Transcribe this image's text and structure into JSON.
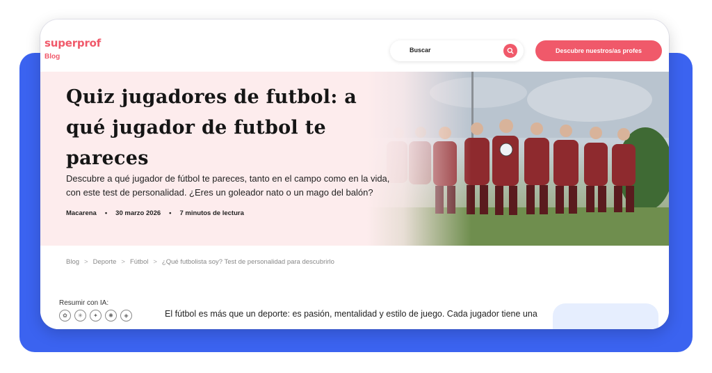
{
  "header": {
    "logo": "superprof",
    "logo_sub": "Blog",
    "search_label": "Buscar",
    "cta_label": "Descubre nuestros/as profes"
  },
  "hero": {
    "title": "Quiz jugadores de futbol: a qué jugador de futbol te pareces",
    "description": "Descubre a qué jugador de fútbol te pareces, tanto en el campo como en la vida, con este test de personalidad. ¿Eres un goleador nato o un mago del balón?",
    "author": "Macarena",
    "date": "30 marzo 2026",
    "reading_time": "7 minutos de lectura",
    "separator": "•"
  },
  "breadcrumb": {
    "items": [
      "Blog",
      "Deporte",
      "Fútbol",
      "¿Qué futbolista soy? Test de personalidad para descubrirlo"
    ],
    "separator": ">"
  },
  "ai_summary": {
    "label": "Resumir con IA:",
    "icons": [
      "chatgpt-icon",
      "perplexity-icon",
      "gemini-icon",
      "claude-icon",
      "grok-icon"
    ]
  },
  "article": {
    "first_line": "El fútbol es más que un deporte: es pasión, mentalidad y estilo de juego. Cada jugador tiene una"
  },
  "colors": {
    "brand": "#f0596a",
    "backdrop": "#3b63f0",
    "hero_bg": "#fdeced",
    "side_card": "#e6eefe"
  }
}
